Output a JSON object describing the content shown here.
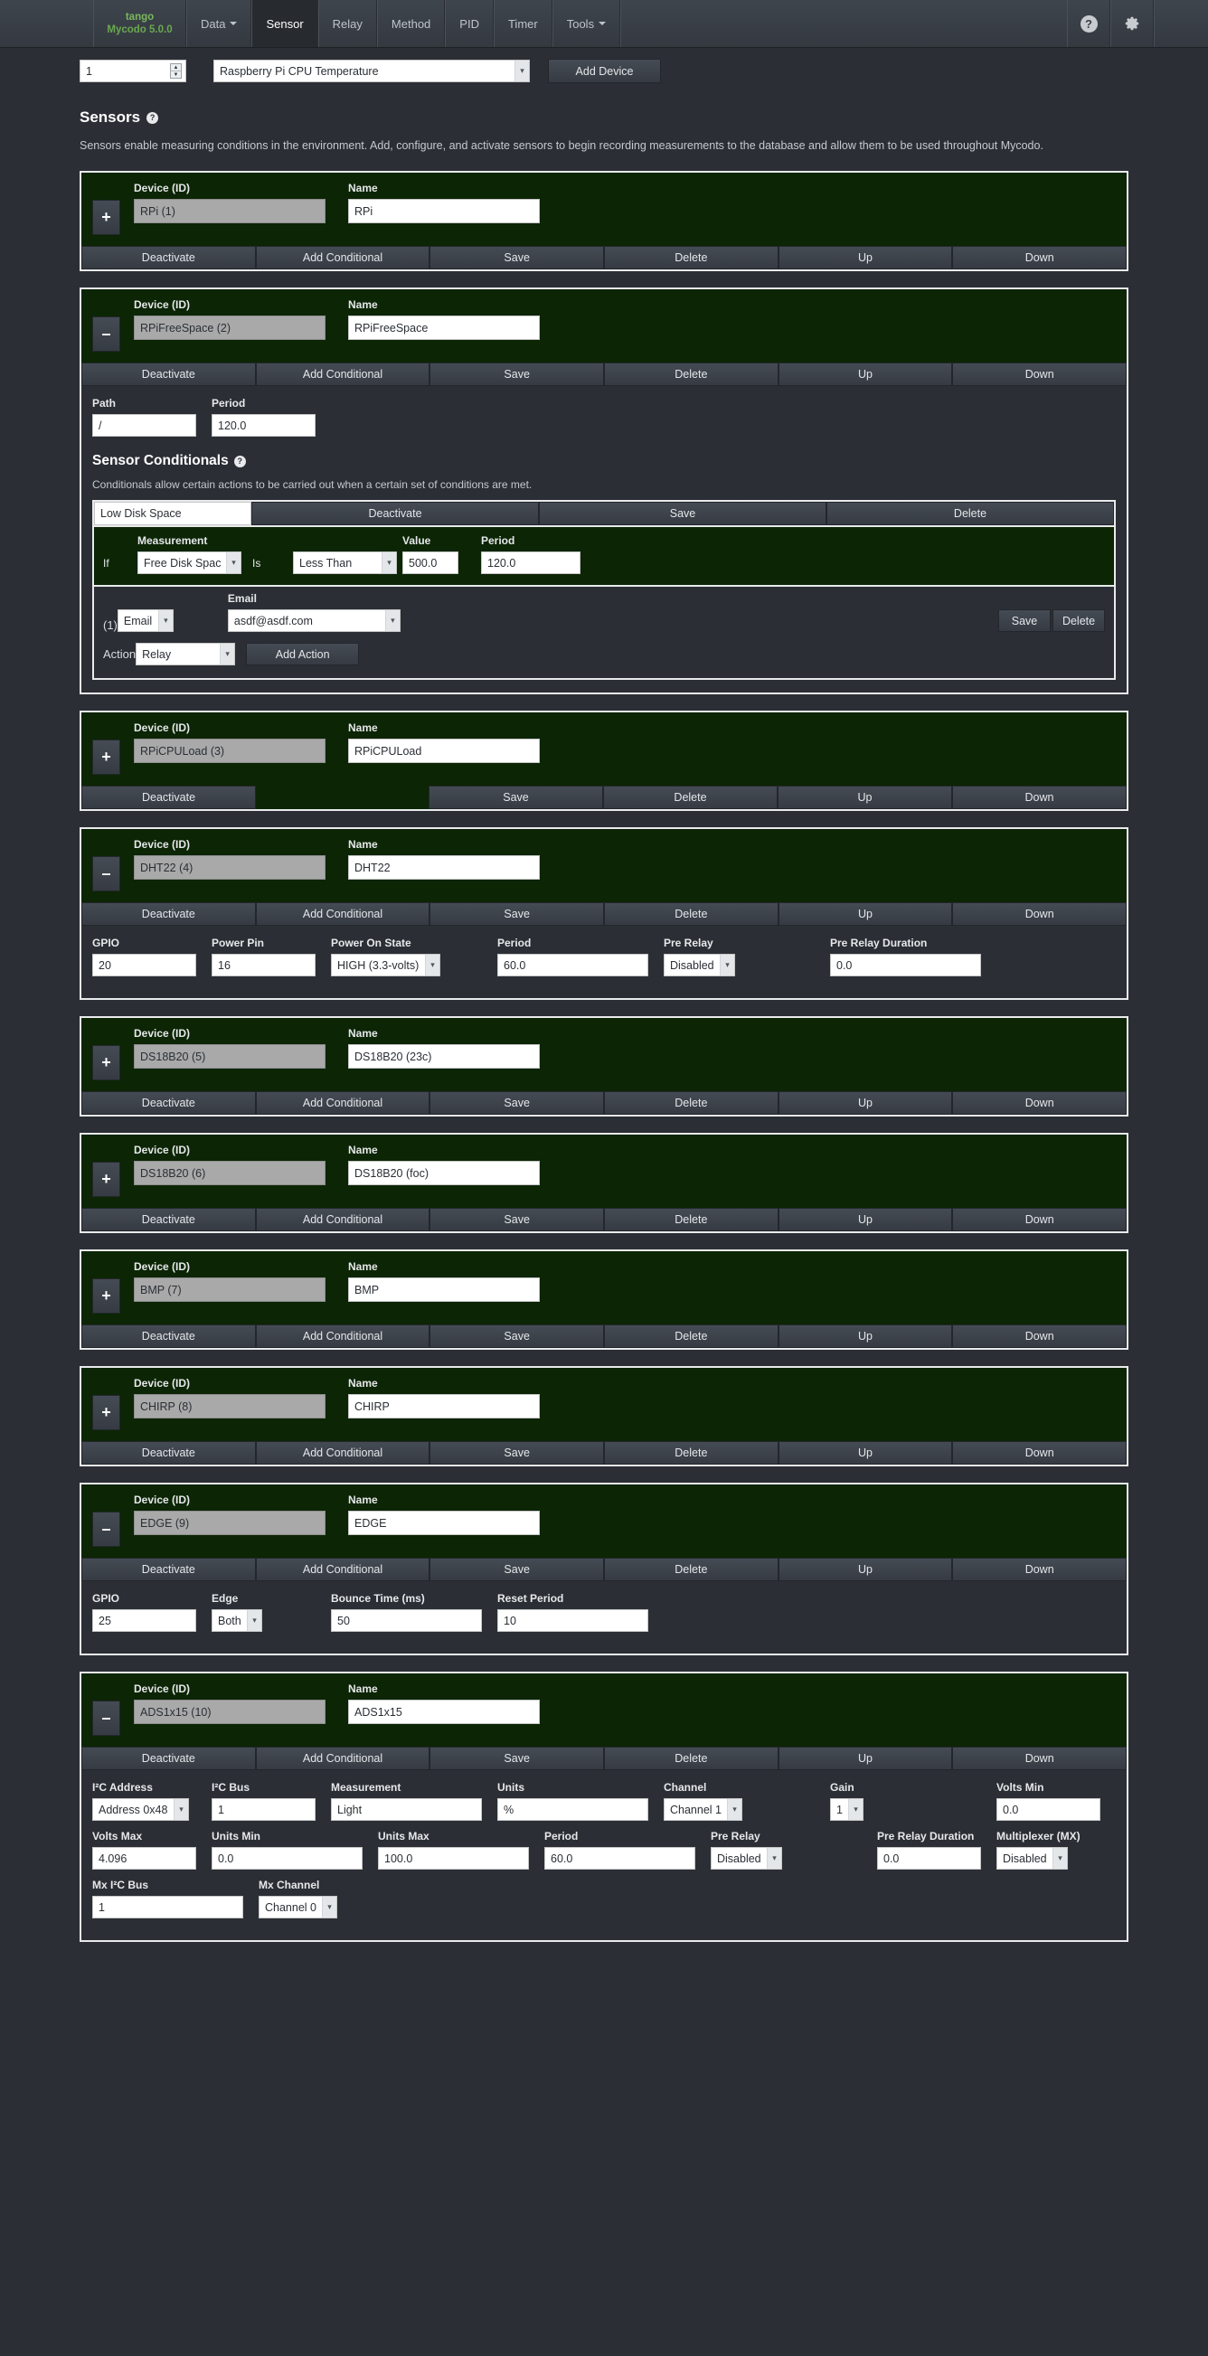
{
  "navbar": {
    "brand_line1": "tango",
    "brand_line2": "Mycodo 5.0.0",
    "items": [
      {
        "label": "Data",
        "caret": true,
        "active": false
      },
      {
        "label": "Sensor",
        "caret": false,
        "active": true
      },
      {
        "label": "Relay",
        "caret": false,
        "active": false
      },
      {
        "label": "Method",
        "caret": false,
        "active": false
      },
      {
        "label": "PID",
        "caret": false,
        "active": false
      },
      {
        "label": "Timer",
        "caret": false,
        "active": false
      },
      {
        "label": "Tools",
        "caret": true,
        "active": false
      }
    ],
    "help_icon": "?",
    "gear_icon": "gear-icon"
  },
  "add_device": {
    "quantity": "1",
    "device_type": "Raspberry Pi CPU Temperature",
    "device_type_options": [
      "Raspberry Pi CPU Temperature"
    ],
    "button_label": "Add Device"
  },
  "sensors_section": {
    "title": "Sensors",
    "description": "Sensors enable measuring conditions in the environment. Add, configure, and activate sensors to begin recording measurements to the database and allow them to be used throughout Mycodo."
  },
  "labels": {
    "device_id": "Device (ID)",
    "name": "Name",
    "expand": "+",
    "collapse": "–"
  },
  "buttons": {
    "deactivate": "Deactivate",
    "add_conditional": "Add Conditional",
    "save": "Save",
    "delete": "Delete",
    "up": "Up",
    "down": "Down",
    "add_action": "Add Action"
  },
  "conditionals_section": {
    "title": "Sensor Conditionals",
    "description": "Conditionals allow certain actions to be carried out when a certain set of conditions are met.",
    "name_value": "Low Disk Space",
    "if_label": "If",
    "is_label": "Is",
    "action_label": "Action",
    "action_index": "(1)",
    "measurement_label": "Measurement",
    "measurement_value": "Free Disk Space",
    "condition_value": "Less Than",
    "value_label": "Value",
    "value": "500.0",
    "period_label": "Period",
    "period": "120.0",
    "email_label": "Email",
    "action_type": "Email",
    "email_value": "asdf@asdf.com",
    "action_select": "Relay"
  },
  "sensors": [
    {
      "toggle": "+",
      "expanded": false,
      "device_id": "RPi (1)",
      "name": "RPi",
      "has_add_conditional": true,
      "options": []
    },
    {
      "toggle": "–",
      "expanded": true,
      "device_id": "RPiFreeSpace (2)",
      "name": "RPiFreeSpace",
      "has_add_conditional": true,
      "options": [
        {
          "label": "Path",
          "value": "/",
          "type": "text"
        },
        {
          "label": "Period",
          "value": "120.0",
          "type": "text"
        }
      ],
      "has_conditionals": true
    },
    {
      "toggle": "+",
      "expanded": false,
      "device_id": "RPiCPULoad (3)",
      "name": "RPiCPULoad",
      "has_add_conditional": false,
      "options": []
    },
    {
      "toggle": "–",
      "expanded": true,
      "device_id": "DHT22 (4)",
      "name": "DHT22",
      "has_add_conditional": true,
      "options": [
        {
          "label": "GPIO",
          "value": "20",
          "type": "text"
        },
        {
          "label": "Power Pin",
          "value": "16",
          "type": "text"
        },
        {
          "label": "Power On State",
          "value": "HIGH (3.3-volts)",
          "type": "select",
          "wide": true
        },
        {
          "label": "Period",
          "value": "60.0",
          "type": "text",
          "wide": true
        },
        {
          "label": "Pre Relay",
          "value": "Disabled",
          "type": "select",
          "wide": true
        },
        {
          "label": "Pre Relay Duration",
          "value": "0.0",
          "type": "text",
          "wide": true
        }
      ]
    },
    {
      "toggle": "+",
      "expanded": false,
      "device_id": "DS18B20 (5)",
      "name": "DS18B20 (23c)",
      "has_add_conditional": true,
      "options": []
    },
    {
      "toggle": "+",
      "expanded": false,
      "device_id": "DS18B20 (6)",
      "name": "DS18B20 (foc)",
      "has_add_conditional": true,
      "options": []
    },
    {
      "toggle": "+",
      "expanded": false,
      "device_id": "BMP (7)",
      "name": "BMP",
      "has_add_conditional": true,
      "options": []
    },
    {
      "toggle": "+",
      "expanded": false,
      "device_id": "CHIRP (8)",
      "name": "CHIRP",
      "has_add_conditional": true,
      "options": []
    },
    {
      "toggle": "–",
      "expanded": true,
      "device_id": "EDGE (9)",
      "name": "EDGE",
      "has_add_conditional": true,
      "options": [
        {
          "label": "GPIO",
          "value": "25",
          "type": "text"
        },
        {
          "label": "Edge",
          "value": "Both",
          "type": "select"
        },
        {
          "label": "Bounce Time (ms)",
          "value": "50",
          "type": "text",
          "wide": true
        },
        {
          "label": "Reset Period",
          "value": "10",
          "type": "text",
          "wide": true
        }
      ]
    },
    {
      "toggle": "–",
      "expanded": true,
      "device_id": "ADS1x15 (10)",
      "name": "ADS1x15",
      "has_add_conditional": true,
      "options": [
        {
          "label": "I²C Address",
          "value": "Address 0x48",
          "type": "select"
        },
        {
          "label": "I²C Bus",
          "value": "1",
          "type": "text"
        },
        {
          "label": "Measurement",
          "value": "Light",
          "type": "text",
          "wide": true
        },
        {
          "label": "Units",
          "value": "%",
          "type": "text",
          "wide": true
        },
        {
          "label": "Channel",
          "value": "Channel 1",
          "type": "select",
          "wide": true
        },
        {
          "label": "Gain",
          "value": "1",
          "type": "select",
          "wide": true
        },
        {
          "label": "Volts Min",
          "value": "0.0",
          "type": "text"
        },
        {
          "label": "Volts Max",
          "value": "4.096",
          "type": "text"
        },
        {
          "label": "Units Min",
          "value": "0.0",
          "type": "text",
          "wide": true
        },
        {
          "label": "Units Max",
          "value": "100.0",
          "type": "text",
          "wide": true
        },
        {
          "label": "Period",
          "value": "60.0",
          "type": "text",
          "wide": true
        },
        {
          "label": "Pre Relay",
          "value": "Disabled",
          "type": "select",
          "wide": true
        },
        {
          "label": "Pre Relay Duration",
          "value": "0.0",
          "type": "text"
        },
        {
          "label": "Multiplexer (MX)",
          "value": "Disabled",
          "type": "select"
        },
        {
          "label": "Mx I²C Bus",
          "value": "1",
          "type": "text",
          "wide": true
        },
        {
          "label": "Mx Channel",
          "value": "Channel 0",
          "type": "select",
          "wide": true
        }
      ]
    }
  ],
  "colors": {
    "page_bg": "#2b2f35",
    "panel_green": "#0c2505",
    "panel_border": "#e9eaec",
    "brand_green": "#6aa84f",
    "button_bg": "#3c424a"
  }
}
